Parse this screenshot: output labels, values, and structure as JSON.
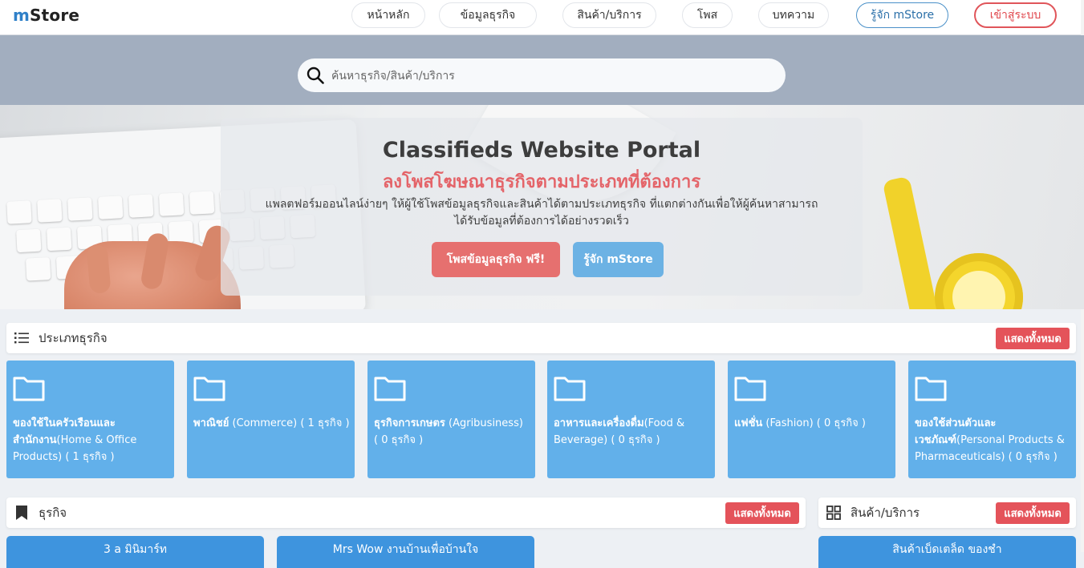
{
  "header": {
    "logo_m": "m",
    "logo_rest": "Store",
    "nav": [
      {
        "label": "หน้าหลัก"
      },
      {
        "label": "ข้อมูลธุรกิจ"
      },
      {
        "label": "สินค้า/บริการ"
      },
      {
        "label": "โพส"
      },
      {
        "label": "บทความ"
      },
      {
        "label": "รู้จัก mStore"
      },
      {
        "label": "เข้าสู่ระบบ"
      }
    ]
  },
  "search": {
    "placeholder": "ค้นหาธุรกิจ/สินค้า/บริการ",
    "icon": "search-icon"
  },
  "hero": {
    "title": "Classifieds Website Portal",
    "subtitle": "ลงโพสโฆษณาธุรกิจตามประเภทที่ต้องการ",
    "description_line1": "แพลตฟอร์มออนไลน์ง่ายๆ ให้ผู้ใช้โพสข้อมูลธุรกิจและสินค้าได้ตามประเภทธุรกิจ ที่แตกต่างกันเพื่อให้ผู้ค้นหาสามารถ",
    "description_line2": "ได้รับข้อมูลที่ต้องการได้อย่างรวดเร็ว",
    "primary_button": "โพสข้อมูลธุรกิจ ฟรี!",
    "secondary_button": "รู้จัก mStore"
  },
  "categories_section": {
    "title": "ประเภทธุรกิจ",
    "show_all": "แสดงทั้งหมด",
    "icon": "list-icon",
    "items": [
      {
        "name_th": "ของใช้ในครัวเรือนและสำนักงาน",
        "name_en": "(Home & Office Products)",
        "count": " ( 1 ธุรกิจ )"
      },
      {
        "name_th": "พาณิชย์",
        "name_en": " (Commerce)",
        "count": " ( 1 ธุรกิจ )"
      },
      {
        "name_th": "ธุรกิจการเกษตร",
        "name_en": " (Agribusiness)",
        "count": " ( 0 ธุรกิจ )"
      },
      {
        "name_th": "อาหารและเครื่องดื่ม",
        "name_en": "(Food & Beverage)",
        "count": " ( 0 ธุรกิจ )"
      },
      {
        "name_th": "แฟชั่น",
        "name_en": " (Fashion)",
        "count": " ( 0 ธุรกิจ )"
      },
      {
        "name_th": "ของใช้ส่วนตัวและเวชภัณฑ์",
        "name_en": "(Personal Products & Pharmaceuticals)",
        "count": " ( 0 ธุรกิจ )"
      }
    ]
  },
  "business_section": {
    "title": "ธุรกิจ",
    "show_all": "แสดงทั้งหมด",
    "icon": "bookmark-icon",
    "cards": [
      {
        "title": "3 a มินิมาร์ท"
      },
      {
        "title": "Mrs Wow งานบ้านเพื่อบ้านใจ"
      }
    ]
  },
  "products_section": {
    "title": "สินค้า/บริการ",
    "show_all": "แสดงทั้งหมด",
    "icon": "grid-icon",
    "cards": [
      {
        "title": "สินค้าเบ็ดเตล็ด ของชำ"
      }
    ]
  },
  "colors": {
    "accent_blue": "#62b0ea",
    "accent_red": "#e4535a",
    "search_band": "#a2aebf"
  }
}
